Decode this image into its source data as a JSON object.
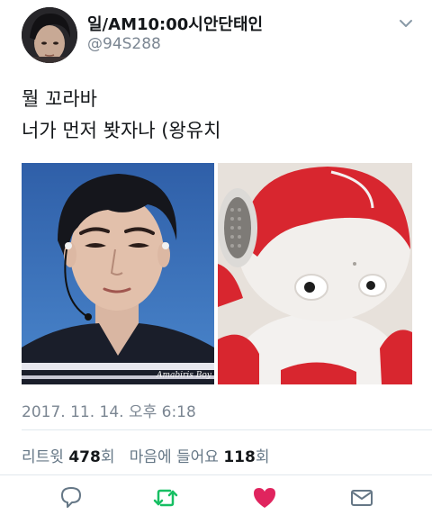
{
  "tweet": {
    "display_name": "일/AM10:00시안단태인",
    "handle": "@94S288",
    "text_lines": [
      "뭘 꼬라바",
      "너가 먼저 봣자나 (왕유치"
    ],
    "timestamp": "2017. 11. 14. 오후 6:18",
    "retweet_label": "리트윗",
    "retweet_count": "478",
    "retweet_unit": "회",
    "like_label": "마음에 들어요",
    "like_count": "118",
    "like_unit": "회",
    "left_photo_watermark": "Amabiris Boy"
  },
  "icons": {
    "avatar": "avatar",
    "caret": "chevron-down-icon",
    "reply": "reply-icon",
    "retweet": "retweet-icon",
    "like": "heart-icon",
    "message": "envelope-icon"
  },
  "colors": {
    "retweet": "#17bf63",
    "like": "#e0245e",
    "secondary_text": "#7b8692",
    "divider": "#e1e8ed"
  }
}
